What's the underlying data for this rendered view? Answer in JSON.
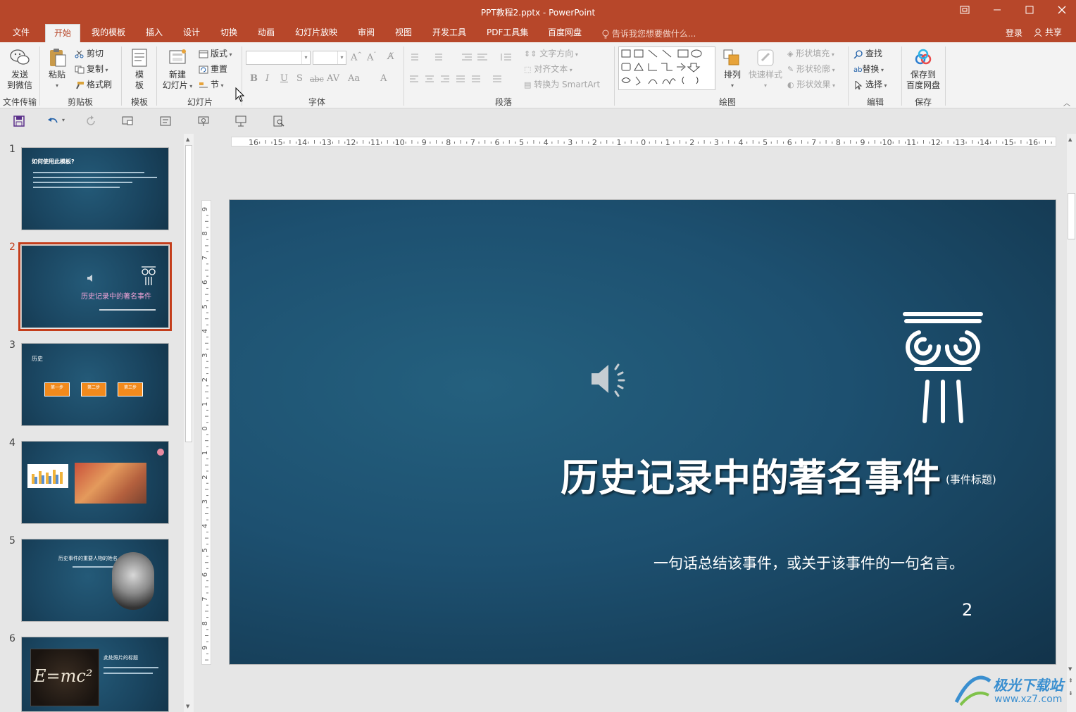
{
  "window": {
    "title": "PPT教程2.pptx - PowerPoint",
    "controls": [
      "restore-ribbon-icon",
      "minimize-icon",
      "maximize-icon",
      "close-icon"
    ]
  },
  "menu": {
    "tabs": [
      {
        "label": "文件"
      },
      {
        "label": "开始",
        "active": true
      },
      {
        "label": "我的模板"
      },
      {
        "label": "插入"
      },
      {
        "label": "设计"
      },
      {
        "label": "切换"
      },
      {
        "label": "动画"
      },
      {
        "label": "幻灯片放映"
      },
      {
        "label": "审阅"
      },
      {
        "label": "视图"
      },
      {
        "label": "开发工具"
      },
      {
        "label": "PDF工具集"
      },
      {
        "label": "百度网盘"
      }
    ],
    "tell_me": "告诉我您想要做什么...",
    "login": "登录",
    "share": "共享"
  },
  "ribbon": {
    "groups": {
      "file_transfer": "文件传输",
      "clipboard": "剪贴板",
      "template": "模板",
      "slides": "幻灯片",
      "font": "字体",
      "paragraph": "段落",
      "drawing": "绘图",
      "editing": "编辑",
      "save": "保存"
    },
    "send_wechat": [
      "发送",
      "到微信"
    ],
    "paste": "粘贴",
    "cut": "剪切",
    "copy": "复制",
    "format_painter": "格式刷",
    "template_btn": [
      "模",
      "板"
    ],
    "new_slide": [
      "新建",
      "幻灯片"
    ],
    "layout": "版式",
    "reset": "重置",
    "section": "节",
    "text_direction": "文字方向",
    "align_text": "对齐文本",
    "convert_smartart": "转换为 SmartArt",
    "arrange": "排列",
    "quick_styles": "快速样式",
    "shape_fill": "形状填充",
    "shape_outline": "形状轮廓",
    "shape_effects": "形状效果",
    "find": "查找",
    "replace": "替换",
    "select": "选择",
    "save_baidu": [
      "保存到",
      "百度网盘"
    ]
  },
  "ruler": {
    "h_labels": [
      "16",
      "15",
      "14",
      "13",
      "12",
      "11",
      "10",
      "9",
      "8",
      "7",
      "6",
      "5",
      "4",
      "3",
      "2",
      "1",
      "0",
      "1",
      "2",
      "3",
      "4",
      "5",
      "6",
      "7",
      "8",
      "9",
      "10",
      "11",
      "12",
      "13",
      "14",
      "15",
      "16"
    ],
    "v_labels": [
      "9",
      "8",
      "7",
      "6",
      "5",
      "4",
      "3",
      "2",
      "1",
      "0",
      "1",
      "2",
      "3",
      "4",
      "5",
      "6",
      "7",
      "8",
      "9"
    ]
  },
  "thumbnails": [
    {
      "num": "1",
      "title": "如何使用此模板?"
    },
    {
      "num": "2",
      "title": "历史记录中的著名事件",
      "selected": true
    },
    {
      "num": "3",
      "title": "历史",
      "steps": [
        "第一步",
        "第二步",
        "第三步"
      ]
    },
    {
      "num": "4",
      "title": ""
    },
    {
      "num": "5",
      "title": "历史事件的重要人物的姓名"
    },
    {
      "num": "6",
      "title": "此处照片的标题",
      "formula": "E=mc²"
    }
  ],
  "slide": {
    "title": "历史记录中的著名事件",
    "title_suffix": "(事件标题)",
    "subtitle": "一句话总结该事件，或关于该事件的一句名言。",
    "page_number": "2"
  },
  "watermark": {
    "line1": "极光下载站",
    "line2": "www.xz7.com"
  },
  "colors": {
    "accent": "#b7472a",
    "selected_thumb": "#c43e1c",
    "slide_bg": "#1d5070"
  }
}
